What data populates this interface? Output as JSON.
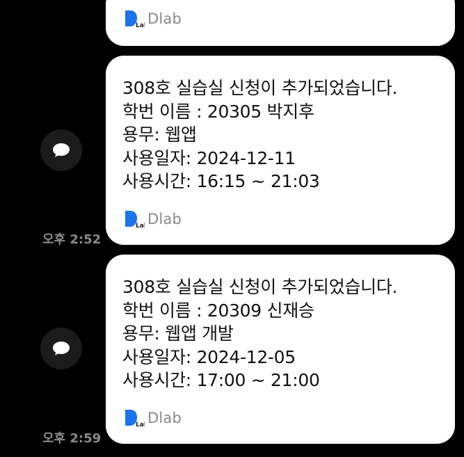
{
  "top_message": {
    "brand": "Dlab",
    "logo_sub": "Lab"
  },
  "messages": [
    {
      "lines": [
        "308호 실습실 신청이 추가되었습니다.",
        "학번 이름 : 20305 박지후",
        "용무: 웹앱",
        "사용일자: 2024-12-11",
        "사용시간: 16:15 ~ 21:03"
      ],
      "brand": "Dlab",
      "logo_sub": "Lab",
      "time": "오후 2:52"
    },
    {
      "lines": [
        "308호 실습실 신청이 추가되었습니다.",
        "학번 이름 : 20309 신재승",
        "용무: 웹앱 개발",
        "사용일자: 2024-12-05",
        "사용시간: 17:00 ~ 21:00"
      ],
      "brand": "Dlab",
      "logo_sub": "Lab",
      "time": "오후 2:59"
    }
  ],
  "colors": {
    "background": "#000000",
    "bubble": "#ffffff",
    "text": "#111111",
    "muted": "#8a8a8a",
    "logo_blue": "#1e73e8",
    "avatar_bg": "#1b1b1b"
  },
  "icons": {
    "avatar": "chat-bubble-icon",
    "logo": "dlab-logo-icon"
  }
}
